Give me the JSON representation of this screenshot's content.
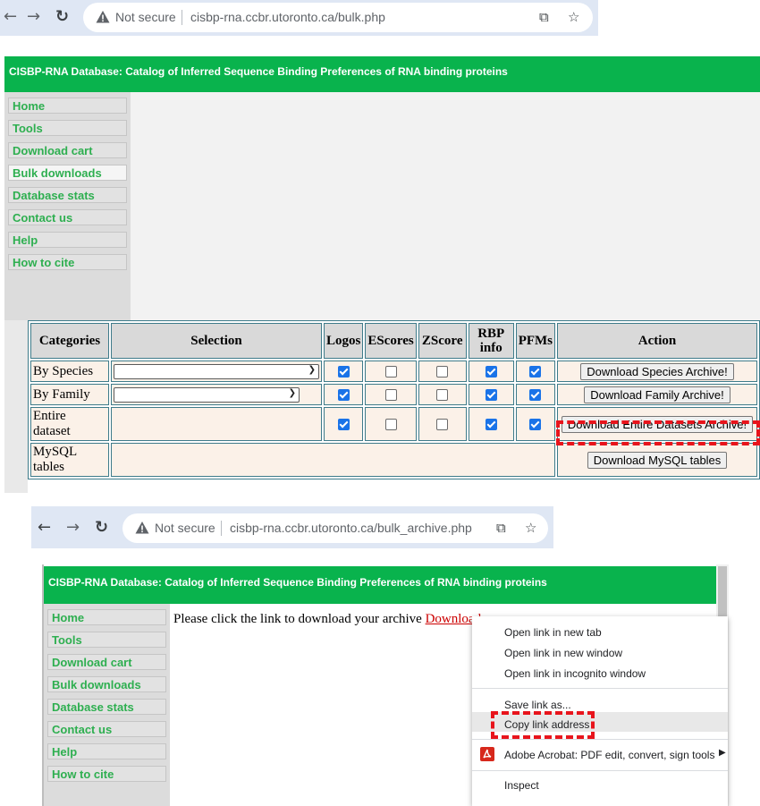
{
  "browser1": {
    "security": "Not secure",
    "url": "cisbp-rna.ccbr.utoronto.ca/bulk.php"
  },
  "browser2": {
    "security": "Not secure",
    "url": "cisbp-rna.ccbr.utoronto.ca/bulk_archive.php"
  },
  "site": {
    "title": "CISBP-RNA Database: Catalog of Inferred Sequence Binding Preferences of RNA binding proteins",
    "nav": [
      "Home",
      "Tools",
      "Download cart",
      "Bulk downloads",
      "Database stats",
      "Contact us",
      "Help",
      "How to cite"
    ],
    "active_nav": "Bulk downloads"
  },
  "bulk_table": {
    "headers": {
      "categories": "Categories",
      "selection": "Selection",
      "logos": "Logos",
      "escores": "EScores",
      "zscore": "ZScore",
      "rbp_info_1": "RBP",
      "rbp_info_2": "info",
      "pfms": "PFMs",
      "action": "Action"
    },
    "rows": [
      {
        "category": "By Species",
        "checks": [
          true,
          false,
          false,
          true,
          true
        ],
        "action": "Download Species Archive!"
      },
      {
        "category": "By Family",
        "checks": [
          true,
          false,
          false,
          true,
          true
        ],
        "action": "Download Family Archive!"
      },
      {
        "category_1": "Entire",
        "category_2": "dataset",
        "checks": [
          true,
          false,
          false,
          true,
          true
        ],
        "action": "Download Entire Datasets Archive!"
      },
      {
        "category_1": "MySQL",
        "category_2": "tables",
        "action": "Download MySQL tables"
      }
    ]
  },
  "archive_page": {
    "message": "Please click the link to download your archive",
    "link_text": "Download"
  },
  "context_menu": {
    "items": [
      "Open link in new tab",
      "Open link in new window",
      "Open link in incognito window",
      "Save link as...",
      "Copy link address",
      "Adobe Acrobat: PDF edit, convert, sign tools",
      "Inspect"
    ],
    "highlighted": "Copy link address"
  },
  "colors": {
    "banner_green": "#09b34d",
    "nav_green": "#2eaf50",
    "highlight_red": "#e8141c",
    "link_red": "#cc0000",
    "checkbox_blue": "#1a73e8"
  }
}
